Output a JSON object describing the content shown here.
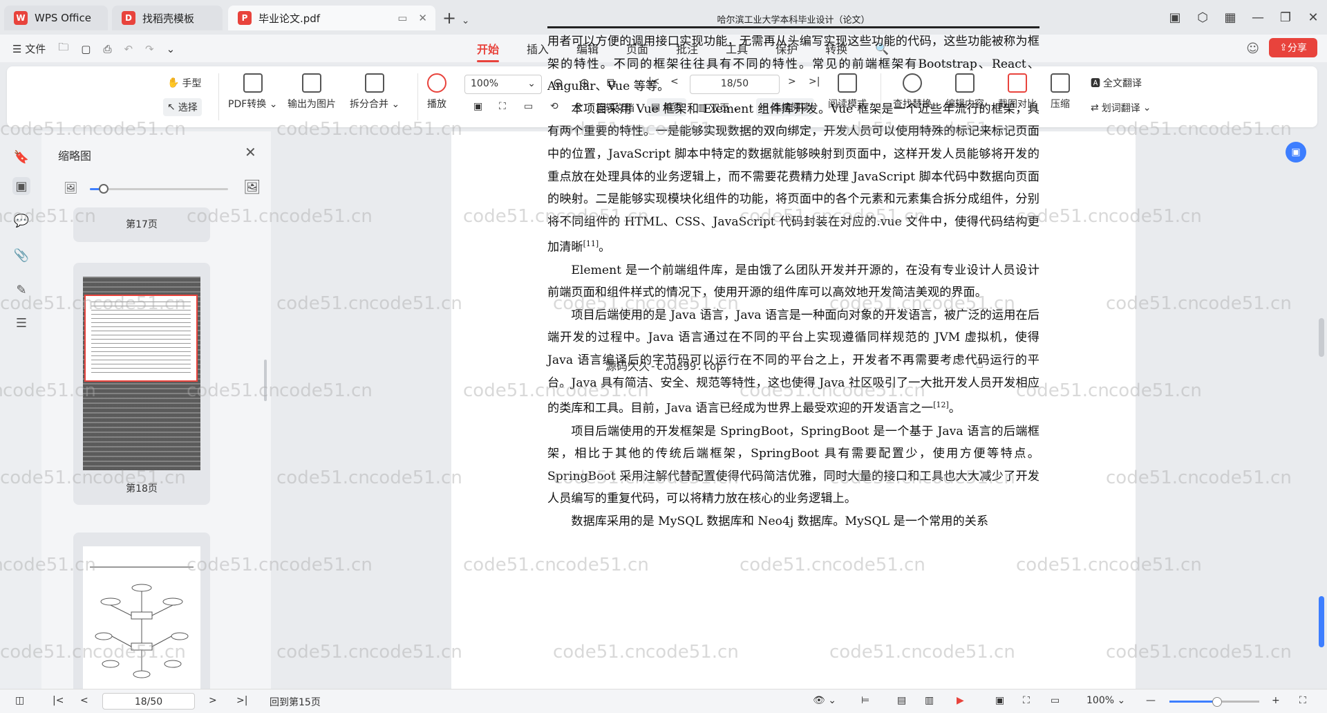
{
  "tabs": [
    {
      "label": "WPS Office",
      "icon": "wps-logo-icon",
      "color": "#e8433c"
    },
    {
      "label": "找稻壳模板",
      "icon": "docer-logo-icon",
      "color": "#e8433c"
    },
    {
      "label": "毕业论文.pdf",
      "icon": "pdf-icon",
      "color": "#e8433c"
    }
  ],
  "menu": {
    "file_label": "文件",
    "items": [
      "开始",
      "插入",
      "编辑",
      "页面",
      "批注",
      "工具",
      "保护",
      "转换"
    ],
    "active": "开始",
    "share_label": "分享"
  },
  "ribbon": {
    "hand_label": "手型",
    "select_label": "选择",
    "pdf_convert_label": "PDF转换",
    "export_image_label": "输出为图片",
    "split_merge_label": "拆分合并",
    "play_label": "播放",
    "zoom_value": "100%",
    "page_value": "18/50",
    "rotate_label": "旋转文档",
    "single_label": "单页",
    "double_label": "双页",
    "continuous_label": "连续阅读",
    "read_mode_label": "阅读模式",
    "find_replace_label": "查找替换",
    "edit_content_label": "编辑内容",
    "compare_label": "截图对比",
    "compress_label": "压缩",
    "full_translate_label": "全文翻译",
    "word_translate_label": "划词翻译"
  },
  "thumbnails": {
    "title": "缩略图",
    "slider_level": 0.1,
    "pages": [
      "第17页",
      "第18页"
    ]
  },
  "document": {
    "header": "哈尔滨工业大学本科毕业设计（论文）",
    "paragraphs": [
      {
        "indent": false,
        "text": "用者可以方便的调用接口实现功能，无需再从头编写实现这些功能的代码，这些功能被称为框架的特性。不同的框架往往具有不同的特性。常见的前端框架有Bootstrap、React、Angular、Vue 等等。"
      },
      {
        "indent": true,
        "text": "本项目采用 Vue 框架和 Element 组件库开发。Vue 框架是一个近些年流行的框架，具有两个重要的特性。一是能够实现数据的双向绑定，开发人员可以使用特殊的标记来标记页面中的位置，JavaScript 脚本中特定的数据就能够映射到页面中，这样开发人员能够将开发的重点放在处理具体的业务逻辑上，而不需要花费精力处理 JavaScript 脚本代码中数据向页面的映射。二是能够实现模块化组件的功能，将页面中的各个元素和元素集合拆分成组件，分别将不同组件的 HTML、CSS、JavaScript 代码封装在对应的.vue 文件中，使得代码结构更加清晰",
        "sup": "[11]",
        "tail": "。"
      },
      {
        "indent": true,
        "text": "Element 是一个前端组件库，是由饿了么团队开发并开源的，在没有专业设计人员设计前端页面和组件样式的情况下，使用开源的组件库可以高效地开发简洁美观的界面。"
      },
      {
        "indent": true,
        "text": "项目后端使用的是 Java 语言，Java 语言是一种面向对象的开发语言，被广泛的运用在后端开发的过程中。Java 语言通过在不同的平台上实现遵循同样规范的 JVM 虚拟机，使得 Java 语言编译后的字节码可以运行在不同的平台之上，开发者不再需要考虑代码运行的平台。Java 具有简洁、安全、规范等特性，这也使得 Java 社区吸引了一大批开发人员开发相应的类库和工具。目前，Java 语言已经成为世界上最受欢迎的开发语言之一",
        "sup": "[12]",
        "tail": "。"
      },
      {
        "indent": true,
        "text": "项目后端使用的开发框架是 SpringBoot，SpringBoot 是一个基于 Java 语言的后端框架，相比于其他的传统后端框架，SpringBoot 具有需要配置少，使用方便等特点。SpringBoot 采用注解代替配置使得代码简洁优雅，同时大量的接口和工具也大大减少了开发人员编写的重复代码，可以将精力放在核心的业务逻辑上。"
      },
      {
        "indent": true,
        "text": "数据库采用的是 MySQL 数据库和 Neo4j 数据库。MySQL 是一个常用的关系"
      }
    ],
    "overlay_text": "源码久久-code99.top",
    "watermark": "code51.cn"
  },
  "status": {
    "page_value": "18/50",
    "back_label": "回到第15页",
    "zoom_label": "100%"
  }
}
